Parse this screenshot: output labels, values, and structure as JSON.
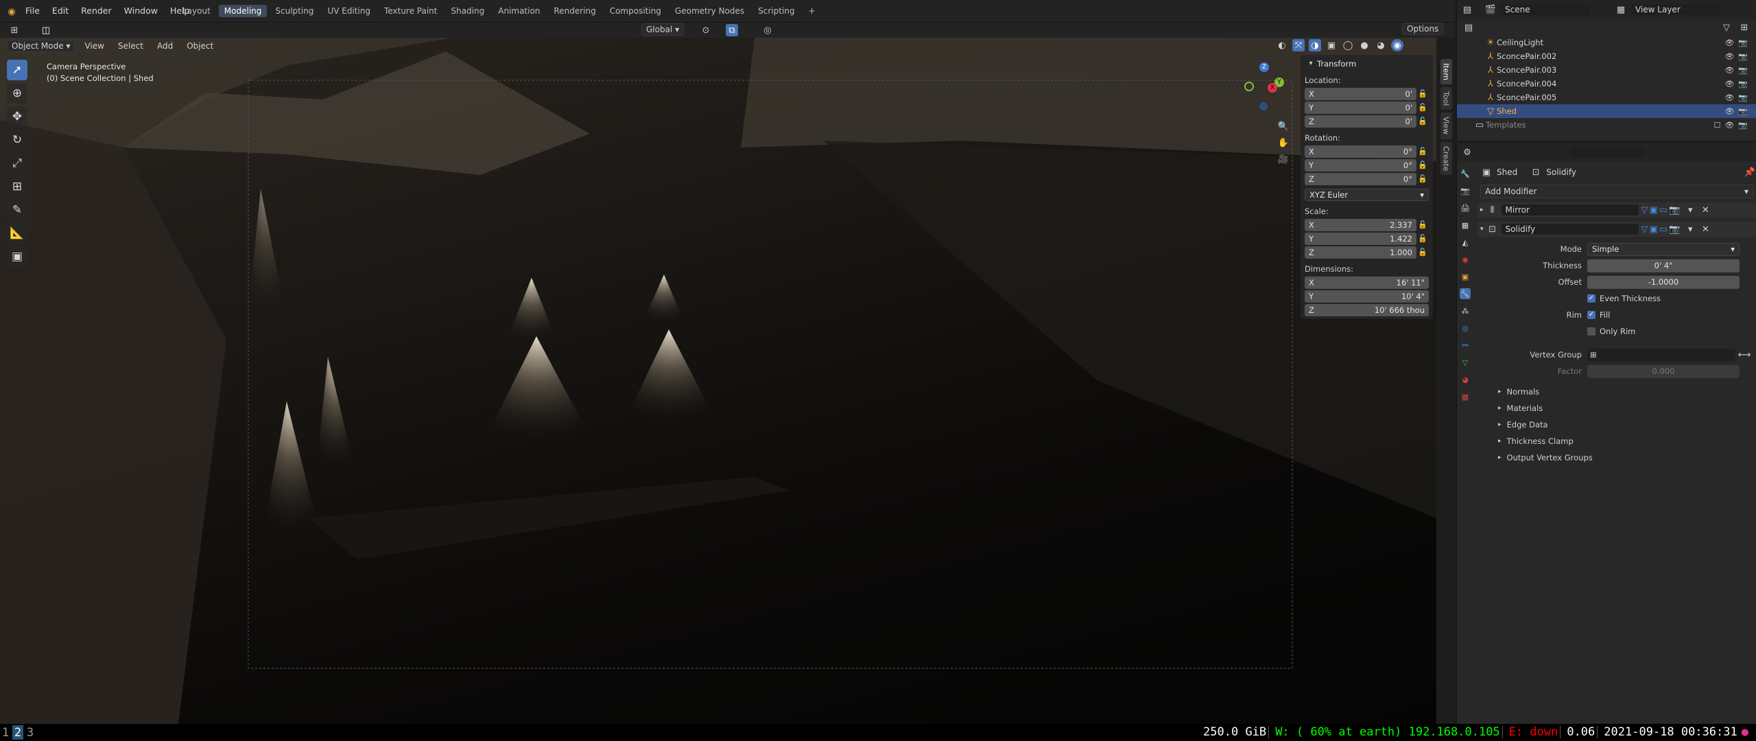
{
  "topbar": {
    "menus": [
      "File",
      "Edit",
      "Render",
      "Window",
      "Help"
    ],
    "workspaces": [
      "Layout",
      "Modeling",
      "Sculpting",
      "UV Editing",
      "Texture Paint",
      "Shading",
      "Animation",
      "Rendering",
      "Compositing",
      "Geometry Nodes",
      "Scripting"
    ],
    "active_workspace": "Modeling",
    "add_tab": "+"
  },
  "toolbar2": {
    "transform_orientation": "Global",
    "options": "Options"
  },
  "viewport": {
    "mode": "Object Mode",
    "menus": [
      "View",
      "Select",
      "Add",
      "Object"
    ],
    "overlay_title": "Camera Perspective",
    "overlay_sub": "(0) Scene Collection | Shed"
  },
  "npanel": {
    "title": "Transform",
    "location_label": "Location:",
    "location": [
      {
        "axis": "X",
        "val": "0'"
      },
      {
        "axis": "Y",
        "val": "0'"
      },
      {
        "axis": "Z",
        "val": "0'"
      }
    ],
    "rotation_label": "Rotation:",
    "rotation": [
      {
        "axis": "X",
        "val": "0°"
      },
      {
        "axis": "Y",
        "val": "0°"
      },
      {
        "axis": "Z",
        "val": "0°"
      }
    ],
    "rotation_mode": "XYZ Euler",
    "scale_label": "Scale:",
    "scale": [
      {
        "axis": "X",
        "val": "2.337"
      },
      {
        "axis": "Y",
        "val": "1.422"
      },
      {
        "axis": "Z",
        "val": "1.000"
      }
    ],
    "dimensions_label": "Dimensions:",
    "dimensions": [
      {
        "axis": "X",
        "val": "16' 11\""
      },
      {
        "axis": "Y",
        "val": "10' 4\""
      },
      {
        "axis": "Z",
        "val": "10' 666 thou"
      }
    ],
    "tabs": [
      "Item",
      "Tool",
      "View",
      "Create"
    ]
  },
  "outliner": {
    "scene": "Scene",
    "view_layer": "View Layer",
    "items": [
      "CeilingLight",
      "SconcePair.002",
      "SconcePair.003",
      "SconcePair.004",
      "SconcePair.005",
      "Shed",
      "Templates"
    ],
    "selected": "Shed"
  },
  "properties": {
    "breadcrumb_object": "Shed",
    "breadcrumb_modifier": "Solidify",
    "add_modifier": "Add Modifier",
    "modifiers": [
      "Mirror",
      "Solidify"
    ],
    "mode_label": "Mode",
    "mode_value": "Simple",
    "thickness_label": "Thickness",
    "thickness_value": "0' 4\"",
    "offset_label": "Offset",
    "offset_value": "-1.0000",
    "even_thickness": "Even Thickness",
    "rim_label": "Rim",
    "fill": "Fill",
    "only_rim": "Only Rim",
    "vertex_group_label": "Vertex Group",
    "factor_label": "Factor",
    "factor_value": "0.000",
    "subpanels": [
      "Normals",
      "Materials",
      "Edge Data",
      "Thickness Clamp",
      "Output Vertex Groups"
    ]
  },
  "statusbar": {
    "workspaces": [
      "1",
      "2",
      "3"
    ],
    "active": "2",
    "disk": "250.0 GiB",
    "wifi": "W: ( 60% at earth) 192.168.0.105",
    "eth": "E: down",
    "load": "0.06",
    "datetime": "2021-09-18 00:36:31",
    "colors": {
      "wifi": "#00ff00",
      "eth": "#ff0000",
      "text": "#ffffff"
    }
  }
}
